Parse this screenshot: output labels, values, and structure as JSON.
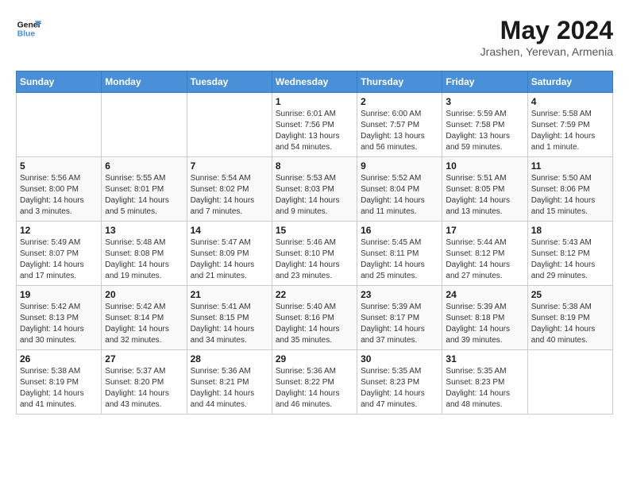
{
  "logo": {
    "line1": "General",
    "line2": "Blue"
  },
  "title": "May 2024",
  "subtitle": "Jrashen, Yerevan, Armenia",
  "weekdays": [
    "Sunday",
    "Monday",
    "Tuesday",
    "Wednesday",
    "Thursday",
    "Friday",
    "Saturday"
  ],
  "weeks": [
    [
      {
        "day": "",
        "sunrise": "",
        "sunset": "",
        "daylight": ""
      },
      {
        "day": "",
        "sunrise": "",
        "sunset": "",
        "daylight": ""
      },
      {
        "day": "",
        "sunrise": "",
        "sunset": "",
        "daylight": ""
      },
      {
        "day": "1",
        "sunrise": "Sunrise: 6:01 AM",
        "sunset": "Sunset: 7:56 PM",
        "daylight": "Daylight: 13 hours and 54 minutes."
      },
      {
        "day": "2",
        "sunrise": "Sunrise: 6:00 AM",
        "sunset": "Sunset: 7:57 PM",
        "daylight": "Daylight: 13 hours and 56 minutes."
      },
      {
        "day": "3",
        "sunrise": "Sunrise: 5:59 AM",
        "sunset": "Sunset: 7:58 PM",
        "daylight": "Daylight: 13 hours and 59 minutes."
      },
      {
        "day": "4",
        "sunrise": "Sunrise: 5:58 AM",
        "sunset": "Sunset: 7:59 PM",
        "daylight": "Daylight: 14 hours and 1 minute."
      }
    ],
    [
      {
        "day": "5",
        "sunrise": "Sunrise: 5:56 AM",
        "sunset": "Sunset: 8:00 PM",
        "daylight": "Daylight: 14 hours and 3 minutes."
      },
      {
        "day": "6",
        "sunrise": "Sunrise: 5:55 AM",
        "sunset": "Sunset: 8:01 PM",
        "daylight": "Daylight: 14 hours and 5 minutes."
      },
      {
        "day": "7",
        "sunrise": "Sunrise: 5:54 AM",
        "sunset": "Sunset: 8:02 PM",
        "daylight": "Daylight: 14 hours and 7 minutes."
      },
      {
        "day": "8",
        "sunrise": "Sunrise: 5:53 AM",
        "sunset": "Sunset: 8:03 PM",
        "daylight": "Daylight: 14 hours and 9 minutes."
      },
      {
        "day": "9",
        "sunrise": "Sunrise: 5:52 AM",
        "sunset": "Sunset: 8:04 PM",
        "daylight": "Daylight: 14 hours and 11 minutes."
      },
      {
        "day": "10",
        "sunrise": "Sunrise: 5:51 AM",
        "sunset": "Sunset: 8:05 PM",
        "daylight": "Daylight: 14 hours and 13 minutes."
      },
      {
        "day": "11",
        "sunrise": "Sunrise: 5:50 AM",
        "sunset": "Sunset: 8:06 PM",
        "daylight": "Daylight: 14 hours and 15 minutes."
      }
    ],
    [
      {
        "day": "12",
        "sunrise": "Sunrise: 5:49 AM",
        "sunset": "Sunset: 8:07 PM",
        "daylight": "Daylight: 14 hours and 17 minutes."
      },
      {
        "day": "13",
        "sunrise": "Sunrise: 5:48 AM",
        "sunset": "Sunset: 8:08 PM",
        "daylight": "Daylight: 14 hours and 19 minutes."
      },
      {
        "day": "14",
        "sunrise": "Sunrise: 5:47 AM",
        "sunset": "Sunset: 8:09 PM",
        "daylight": "Daylight: 14 hours and 21 minutes."
      },
      {
        "day": "15",
        "sunrise": "Sunrise: 5:46 AM",
        "sunset": "Sunset: 8:10 PM",
        "daylight": "Daylight: 14 hours and 23 minutes."
      },
      {
        "day": "16",
        "sunrise": "Sunrise: 5:45 AM",
        "sunset": "Sunset: 8:11 PM",
        "daylight": "Daylight: 14 hours and 25 minutes."
      },
      {
        "day": "17",
        "sunrise": "Sunrise: 5:44 AM",
        "sunset": "Sunset: 8:12 PM",
        "daylight": "Daylight: 14 hours and 27 minutes."
      },
      {
        "day": "18",
        "sunrise": "Sunrise: 5:43 AM",
        "sunset": "Sunset: 8:12 PM",
        "daylight": "Daylight: 14 hours and 29 minutes."
      }
    ],
    [
      {
        "day": "19",
        "sunrise": "Sunrise: 5:42 AM",
        "sunset": "Sunset: 8:13 PM",
        "daylight": "Daylight: 14 hours and 30 minutes."
      },
      {
        "day": "20",
        "sunrise": "Sunrise: 5:42 AM",
        "sunset": "Sunset: 8:14 PM",
        "daylight": "Daylight: 14 hours and 32 minutes."
      },
      {
        "day": "21",
        "sunrise": "Sunrise: 5:41 AM",
        "sunset": "Sunset: 8:15 PM",
        "daylight": "Daylight: 14 hours and 34 minutes."
      },
      {
        "day": "22",
        "sunrise": "Sunrise: 5:40 AM",
        "sunset": "Sunset: 8:16 PM",
        "daylight": "Daylight: 14 hours and 35 minutes."
      },
      {
        "day": "23",
        "sunrise": "Sunrise: 5:39 AM",
        "sunset": "Sunset: 8:17 PM",
        "daylight": "Daylight: 14 hours and 37 minutes."
      },
      {
        "day": "24",
        "sunrise": "Sunrise: 5:39 AM",
        "sunset": "Sunset: 8:18 PM",
        "daylight": "Daylight: 14 hours and 39 minutes."
      },
      {
        "day": "25",
        "sunrise": "Sunrise: 5:38 AM",
        "sunset": "Sunset: 8:19 PM",
        "daylight": "Daylight: 14 hours and 40 minutes."
      }
    ],
    [
      {
        "day": "26",
        "sunrise": "Sunrise: 5:38 AM",
        "sunset": "Sunset: 8:19 PM",
        "daylight": "Daylight: 14 hours and 41 minutes."
      },
      {
        "day": "27",
        "sunrise": "Sunrise: 5:37 AM",
        "sunset": "Sunset: 8:20 PM",
        "daylight": "Daylight: 14 hours and 43 minutes."
      },
      {
        "day": "28",
        "sunrise": "Sunrise: 5:36 AM",
        "sunset": "Sunset: 8:21 PM",
        "daylight": "Daylight: 14 hours and 44 minutes."
      },
      {
        "day": "29",
        "sunrise": "Sunrise: 5:36 AM",
        "sunset": "Sunset: 8:22 PM",
        "daylight": "Daylight: 14 hours and 46 minutes."
      },
      {
        "day": "30",
        "sunrise": "Sunrise: 5:35 AM",
        "sunset": "Sunset: 8:23 PM",
        "daylight": "Daylight: 14 hours and 47 minutes."
      },
      {
        "day": "31",
        "sunrise": "Sunrise: 5:35 AM",
        "sunset": "Sunset: 8:23 PM",
        "daylight": "Daylight: 14 hours and 48 minutes."
      },
      {
        "day": "",
        "sunrise": "",
        "sunset": "",
        "daylight": ""
      }
    ]
  ]
}
